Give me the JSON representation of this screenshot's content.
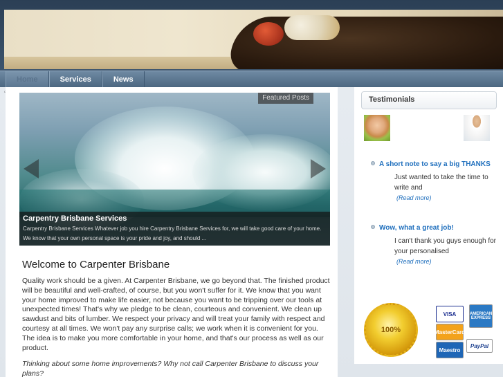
{
  "nav": {
    "items": [
      {
        "label": "Home"
      },
      {
        "label": "Services"
      },
      {
        "label": "News"
      }
    ]
  },
  "tiny_label": "Carpenter Brisbane",
  "slider": {
    "tag": "Featured Posts",
    "caption_title": "Carpentry Brisbane Services",
    "caption_text": "Carpentry Brisbane Services Whatever job you hire Carpentry Brisbane Services for, we will take good care of your home. We know that your own personal space is your pride and joy, and should ..."
  },
  "article": {
    "heading": "Welcome to Carpenter Brisbane",
    "body": "Quality work should be a given.  At Carpenter Brisbane, we go beyond that.  The finished product will be beautiful and well-crafted, of course, but you won't suffer for it.  We know that you want your home improved to make life easier, not because you want to be tripping over our tools at unexpected times!  That's why we pledge to be clean, courteous and convenient.  We clean up sawdust and bits of lumber.  We respect your privacy and will treat your family with respect and courtesy at all times.  We won't pay any surprise calls; we work when it is convenient for you.  The idea is to make you more comfortable in your home, and that's our process as well as our product.",
    "question": "Thinking about some home improvements?  Why not call Carpenter Brisbane to discuss your plans?"
  },
  "sidebar": {
    "heading": "Testimonials",
    "items": [
      {
        "title": "A short note to say a big THANKS",
        "body": "Just wanted to take the time to write and",
        "more": "(Read more)"
      },
      {
        "title": "Wow, what a great job!",
        "body": "I can't thank you guys enough for your personalised",
        "more": "(Read more)"
      }
    ],
    "seal_text": "100%",
    "cards": {
      "visa": "VISA",
      "amex": "AMERICAN EXPRESS",
      "mastercard": "MasterCard",
      "maestro": "Maestro",
      "paypal": "PayPal"
    }
  }
}
